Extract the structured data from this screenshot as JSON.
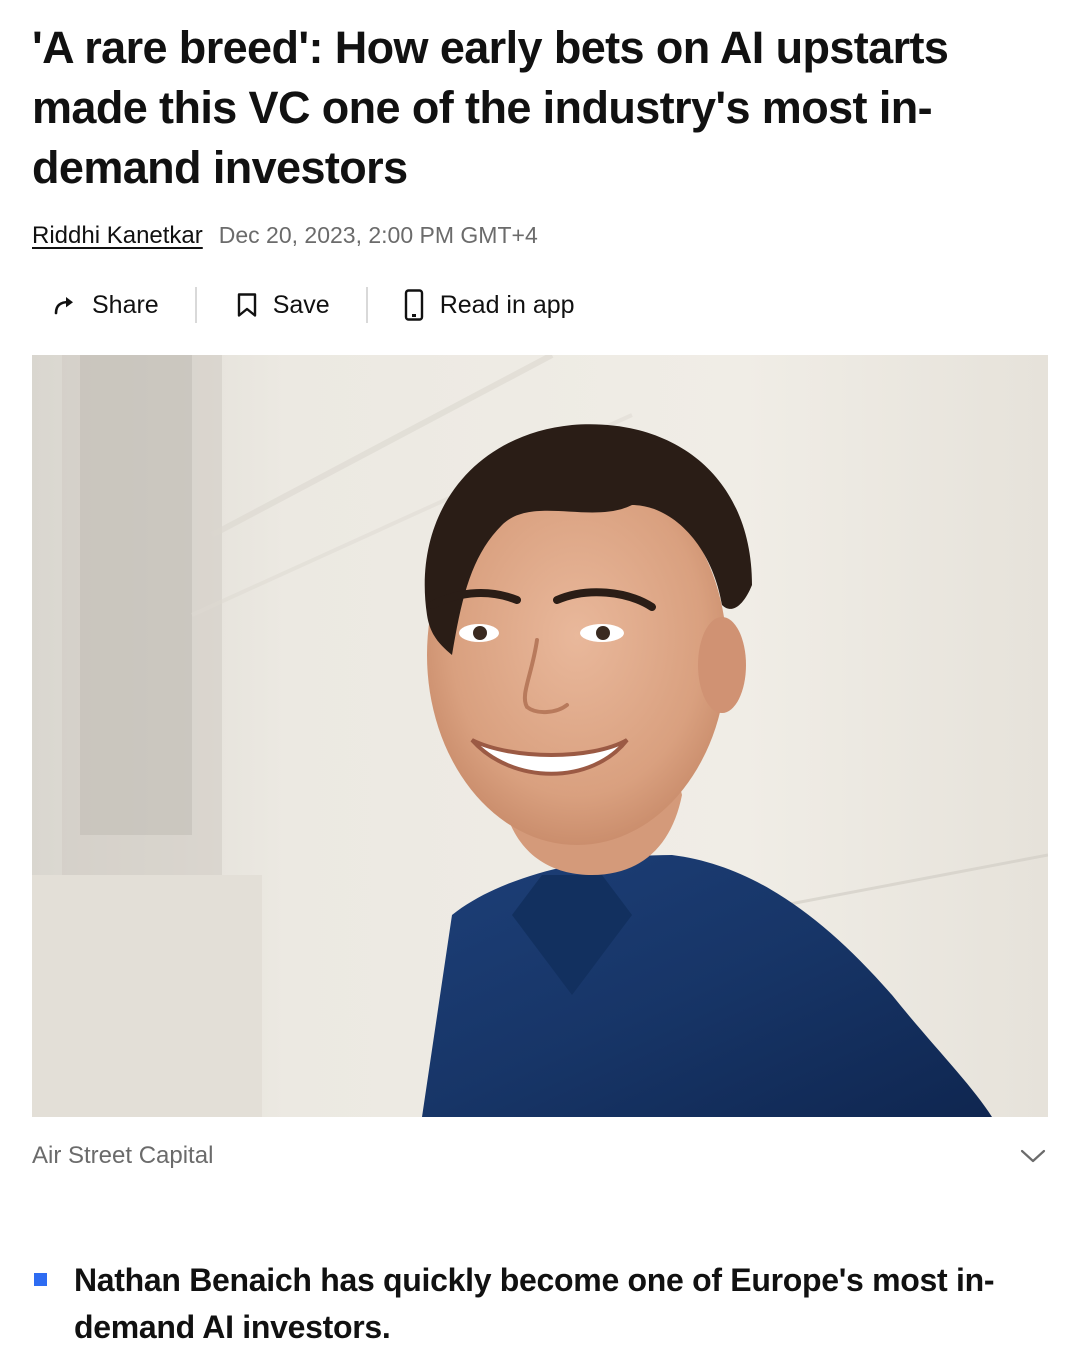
{
  "article": {
    "headline": "'A rare breed': How early bets on AI upstarts made this VC one of the industry's most in-demand investors",
    "author": "Riddhi Kanetkar",
    "date": "Dec 20, 2023, 2:00 PM GMT+4"
  },
  "actions": {
    "share_label": "Share",
    "save_label": "Save",
    "read_in_app_label": "Read in app",
    "share_icon": "share-arrow-icon",
    "save_icon": "bookmark-icon",
    "app_icon": "phone-icon"
  },
  "image": {
    "caption": "Air Street Capital",
    "expand_icon": "chevron-down-icon"
  },
  "summary": {
    "bullets": [
      "Nathan Benaich has quickly become one of Europe's most in-demand AI investors."
    ]
  },
  "colors": {
    "bullet": "#2e6cf2",
    "text": "#111111",
    "muted": "#6b6b6b"
  }
}
